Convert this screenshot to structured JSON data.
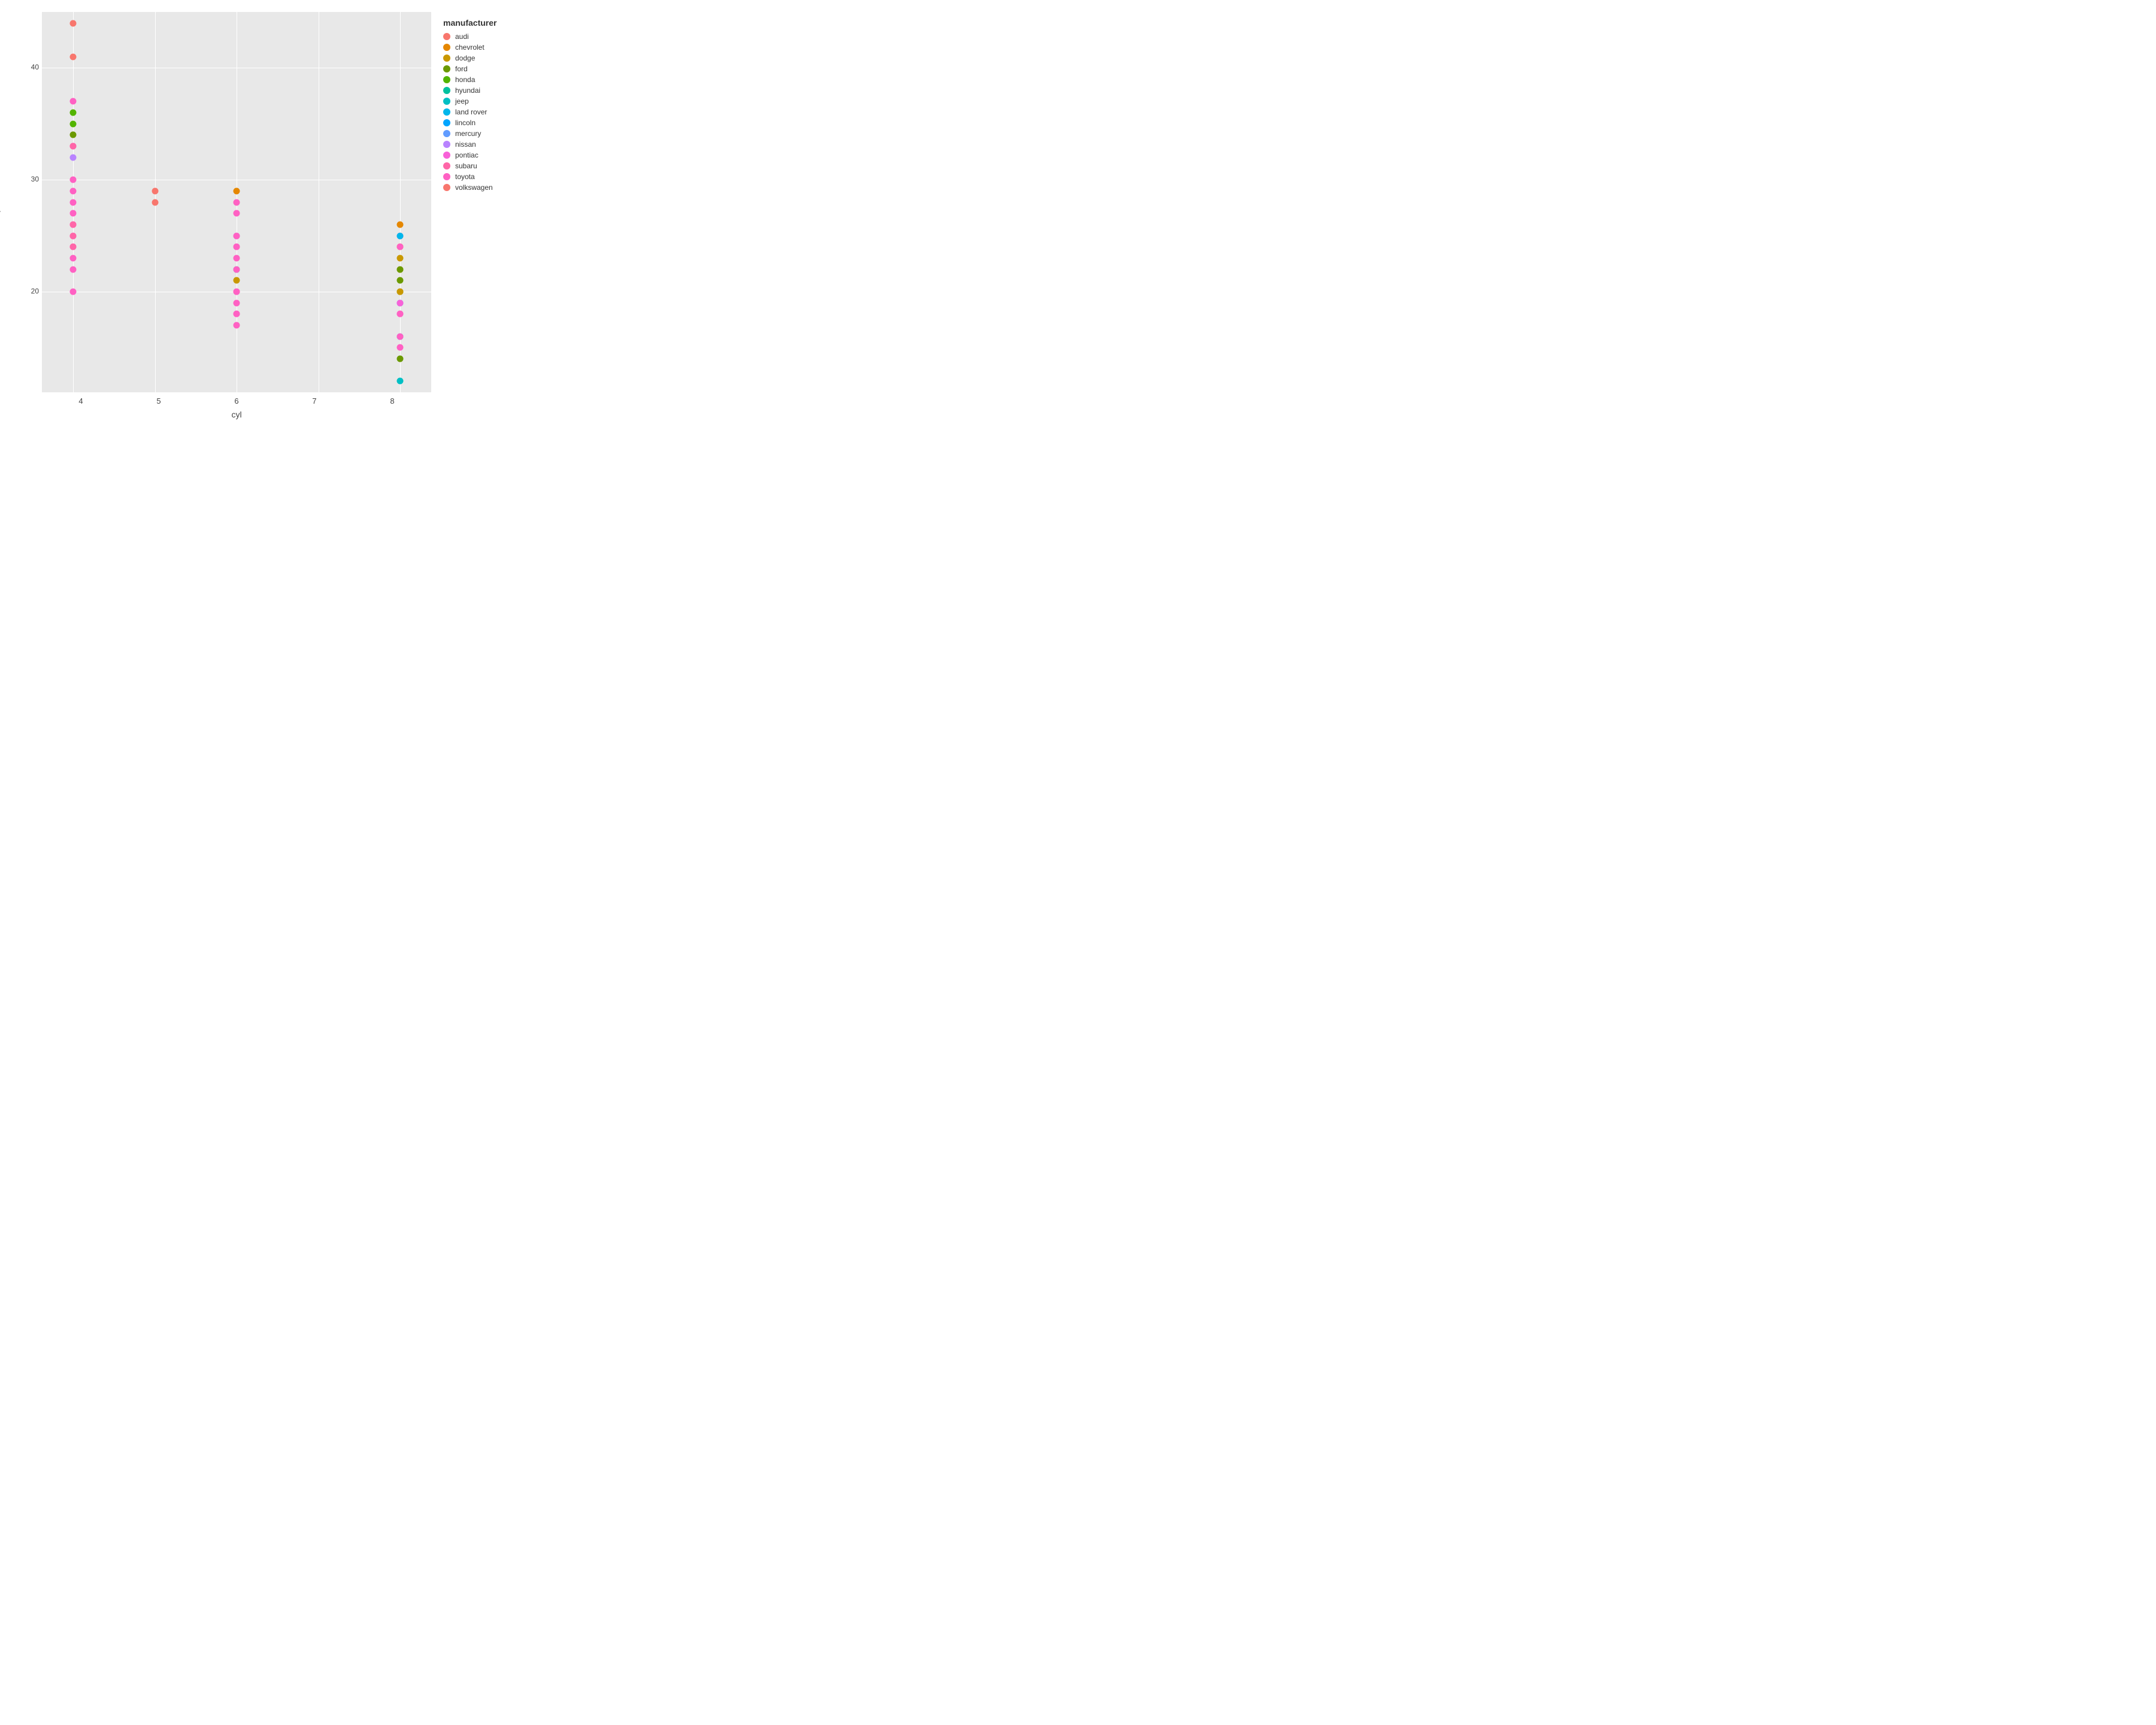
{
  "chart": {
    "title": "",
    "x_axis_label": "cyl",
    "y_axis_label": "hwy",
    "x_ticks": [
      "4",
      "5",
      "6",
      "7",
      "8"
    ],
    "y_ticks": [
      "20",
      "30",
      "40"
    ],
    "y_min": 11,
    "y_max": 45,
    "x_categories": [
      4,
      5,
      6,
      7,
      8
    ],
    "plot_bg": "#e8e8e8",
    "grid_color": "#ffffff"
  },
  "legend": {
    "title": "manufacturer",
    "items": [
      {
        "label": "audi",
        "color": "#F8766D"
      },
      {
        "label": "chevrolet",
        "color": "#E58700"
      },
      {
        "label": "dodge",
        "color": "#C99800"
      },
      {
        "label": "ford",
        "color": "#6B9900"
      },
      {
        "label": "honda",
        "color": "#53B400"
      },
      {
        "label": "hyundai",
        "color": "#00C19F"
      },
      {
        "label": "jeep",
        "color": "#00BFC4"
      },
      {
        "label": "land rover",
        "color": "#00B6EB"
      },
      {
        "label": "lincoln",
        "color": "#00A5FF"
      },
      {
        "label": "mercury",
        "color": "#619CFF"
      },
      {
        "label": "nissan",
        "color": "#B983FF"
      },
      {
        "label": "pontiac",
        "color": "#F861D8"
      },
      {
        "label": "subaru",
        "color": "#FF66A8"
      },
      {
        "label": "toyota",
        "color": "#FF61C3"
      },
      {
        "label": "volkswagen",
        "color": "#F8766D"
      }
    ]
  },
  "data_points": [
    {
      "cyl": 4,
      "hwy": 44,
      "manufacturer": "volkswagen",
      "color": "#F8766D"
    },
    {
      "cyl": 4,
      "hwy": 41,
      "manufacturer": "volkswagen",
      "color": "#F8766D"
    },
    {
      "cyl": 4,
      "hwy": 37,
      "manufacturer": "toyota",
      "color": "#FF61C3"
    },
    {
      "cyl": 4,
      "hwy": 36,
      "manufacturer": "honda",
      "color": "#53B400"
    },
    {
      "cyl": 4,
      "hwy": 35,
      "manufacturer": "honda",
      "color": "#53B400"
    },
    {
      "cyl": 4,
      "hwy": 34,
      "manufacturer": "ford",
      "color": "#6B9900"
    },
    {
      "cyl": 4,
      "hwy": 33,
      "manufacturer": "toyota",
      "color": "#FF61C3"
    },
    {
      "cyl": 4,
      "hwy": 33,
      "manufacturer": "subaru",
      "color": "#FF66A8"
    },
    {
      "cyl": 4,
      "hwy": 32,
      "manufacturer": "nissan",
      "color": "#B983FF"
    },
    {
      "cyl": 4,
      "hwy": 30,
      "manufacturer": "toyota",
      "color": "#FF61C3"
    },
    {
      "cyl": 4,
      "hwy": 29,
      "manufacturer": "toyota",
      "color": "#FF61C3"
    },
    {
      "cyl": 4,
      "hwy": 28,
      "manufacturer": "toyota",
      "color": "#FF61C3"
    },
    {
      "cyl": 4,
      "hwy": 27,
      "manufacturer": "toyota",
      "color": "#FF61C3"
    },
    {
      "cyl": 4,
      "hwy": 26,
      "manufacturer": "toyota",
      "color": "#FF61C3"
    },
    {
      "cyl": 4,
      "hwy": 26,
      "manufacturer": "subaru",
      "color": "#FF66A8"
    },
    {
      "cyl": 4,
      "hwy": 25,
      "manufacturer": "toyota",
      "color": "#FF61C3"
    },
    {
      "cyl": 4,
      "hwy": 25,
      "manufacturer": "subaru",
      "color": "#FF66A8"
    },
    {
      "cyl": 4,
      "hwy": 24,
      "manufacturer": "toyota",
      "color": "#FF61C3"
    },
    {
      "cyl": 4,
      "hwy": 24,
      "manufacturer": "subaru",
      "color": "#FF66A8"
    },
    {
      "cyl": 4,
      "hwy": 23,
      "manufacturer": "toyota",
      "color": "#FF61C3"
    },
    {
      "cyl": 4,
      "hwy": 22,
      "manufacturer": "toyota",
      "color": "#FF61C3"
    },
    {
      "cyl": 4,
      "hwy": 20,
      "manufacturer": "toyota",
      "color": "#FF61C3"
    },
    {
      "cyl": 5,
      "hwy": 29,
      "manufacturer": "volkswagen",
      "color": "#F8766D"
    },
    {
      "cyl": 5,
      "hwy": 28,
      "manufacturer": "volkswagen",
      "color": "#F8766D"
    },
    {
      "cyl": 6,
      "hwy": 29,
      "manufacturer": "chevrolet",
      "color": "#E58700"
    },
    {
      "cyl": 6,
      "hwy": 28,
      "manufacturer": "toyota",
      "color": "#FF61C3"
    },
    {
      "cyl": 6,
      "hwy": 27,
      "manufacturer": "toyota",
      "color": "#FF61C3"
    },
    {
      "cyl": 6,
      "hwy": 25,
      "manufacturer": "nissan",
      "color": "#B983FF"
    },
    {
      "cyl": 6,
      "hwy": 25,
      "manufacturer": "toyota",
      "color": "#FF61C3"
    },
    {
      "cyl": 6,
      "hwy": 24,
      "manufacturer": "toyota",
      "color": "#FF61C3"
    },
    {
      "cyl": 6,
      "hwy": 24,
      "manufacturer": "toyota",
      "color": "#FF61C3"
    },
    {
      "cyl": 6,
      "hwy": 23,
      "manufacturer": "toyota",
      "color": "#FF61C3"
    },
    {
      "cyl": 6,
      "hwy": 22,
      "manufacturer": "jeep",
      "color": "#00BFC4"
    },
    {
      "cyl": 6,
      "hwy": 22,
      "manufacturer": "toyota",
      "color": "#FF61C3"
    },
    {
      "cyl": 6,
      "hwy": 21,
      "manufacturer": "dodge",
      "color": "#C99800"
    },
    {
      "cyl": 6,
      "hwy": 20,
      "manufacturer": "toyota",
      "color": "#FF61C3"
    },
    {
      "cyl": 6,
      "hwy": 20,
      "manufacturer": "toyota",
      "color": "#FF61C3"
    },
    {
      "cyl": 6,
      "hwy": 19,
      "manufacturer": "toyota",
      "color": "#FF61C3"
    },
    {
      "cyl": 6,
      "hwy": 18,
      "manufacturer": "toyota",
      "color": "#FF61C3"
    },
    {
      "cyl": 6,
      "hwy": 18,
      "manufacturer": "toyota",
      "color": "#FF61C3"
    },
    {
      "cyl": 6,
      "hwy": 17,
      "manufacturer": "toyota",
      "color": "#FF61C3"
    },
    {
      "cyl": 8,
      "hwy": 26,
      "manufacturer": "chevrolet",
      "color": "#E58700"
    },
    {
      "cyl": 8,
      "hwy": 25,
      "manufacturer": "toyota",
      "color": "#FF61C3"
    },
    {
      "cyl": 8,
      "hwy": 25,
      "manufacturer": "land rover",
      "color": "#00B6EB"
    },
    {
      "cyl": 8,
      "hwy": 24,
      "manufacturer": "chevrolet",
      "color": "#E58700"
    },
    {
      "cyl": 8,
      "hwy": 24,
      "manufacturer": "toyota",
      "color": "#FF61C3"
    },
    {
      "cyl": 8,
      "hwy": 23,
      "manufacturer": "dodge",
      "color": "#C99800"
    },
    {
      "cyl": 8,
      "hwy": 22,
      "manufacturer": "dodge",
      "color": "#C99800"
    },
    {
      "cyl": 8,
      "hwy": 22,
      "manufacturer": "ford",
      "color": "#6B9900"
    },
    {
      "cyl": 8,
      "hwy": 21,
      "manufacturer": "ford",
      "color": "#6B9900"
    },
    {
      "cyl": 8,
      "hwy": 20,
      "manufacturer": "ford",
      "color": "#6B9900"
    },
    {
      "cyl": 8,
      "hwy": 20,
      "manufacturer": "dodge",
      "color": "#C99800"
    },
    {
      "cyl": 8,
      "hwy": 19,
      "manufacturer": "lincoln",
      "color": "#00A5FF"
    },
    {
      "cyl": 8,
      "hwy": 19,
      "manufacturer": "pontiac",
      "color": "#F861D8"
    },
    {
      "cyl": 8,
      "hwy": 18,
      "manufacturer": "toyota",
      "color": "#FF61C3"
    },
    {
      "cyl": 8,
      "hwy": 18,
      "manufacturer": "toyota",
      "color": "#FF61C3"
    },
    {
      "cyl": 8,
      "hwy": 16,
      "manufacturer": "lincoln",
      "color": "#00A5FF"
    },
    {
      "cyl": 8,
      "hwy": 16,
      "manufacturer": "toyota",
      "color": "#FF61C3"
    },
    {
      "cyl": 8,
      "hwy": 15,
      "manufacturer": "toyota",
      "color": "#FF61C3"
    },
    {
      "cyl": 8,
      "hwy": 14,
      "manufacturer": "ford",
      "color": "#6B9900"
    },
    {
      "cyl": 8,
      "hwy": 12,
      "manufacturer": "land rover",
      "color": "#00BFC4"
    }
  ]
}
